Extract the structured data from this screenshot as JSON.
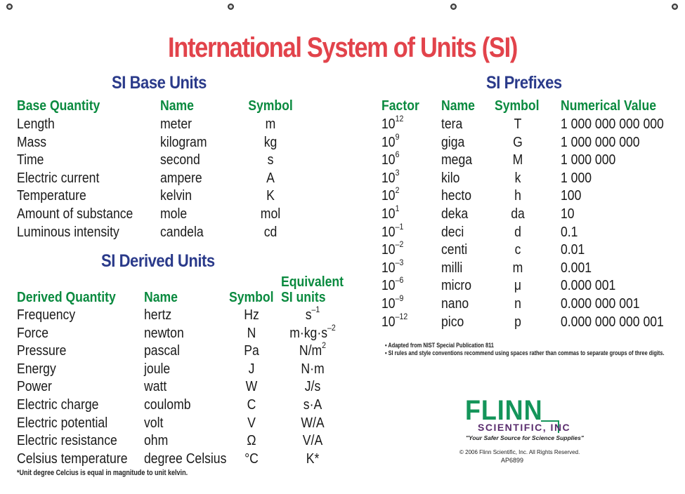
{
  "title": "International System of Units (SI)",
  "base_units": {
    "heading": "SI Base Units",
    "columns": [
      "Base Quantity",
      "Name",
      "Symbol"
    ],
    "rows": [
      [
        "Length",
        "meter",
        "m"
      ],
      [
        "Mass",
        "kilogram",
        "kg"
      ],
      [
        "Time",
        "second",
        "s"
      ],
      [
        "Electric current",
        "ampere",
        "A"
      ],
      [
        "Temperature",
        "kelvin",
        "K"
      ],
      [
        "Amount of substance",
        "mole",
        "mol"
      ],
      [
        "Luminous intensity",
        "candela",
        "cd"
      ]
    ]
  },
  "derived_units": {
    "heading": "SI Derived Units",
    "columns": [
      "Derived Quantity",
      "Name",
      "Symbol",
      "Equivalent",
      "SI units"
    ],
    "rows": [
      {
        "q": "Frequency",
        "name": "hertz",
        "sym": "Hz",
        "eq": "s",
        "eq_sup": "–1",
        "eq_tail": ""
      },
      {
        "q": "Force",
        "name": "newton",
        "sym": "N",
        "eq": "m·kg·s",
        "eq_sup": "–2",
        "eq_tail": ""
      },
      {
        "q": "Pressure",
        "name": "pascal",
        "sym": "Pa",
        "eq": "N/m",
        "eq_sup": "2",
        "eq_tail": ""
      },
      {
        "q": "Energy",
        "name": "joule",
        "sym": "J",
        "eq": "N·m",
        "eq_sup": "",
        "eq_tail": ""
      },
      {
        "q": "Power",
        "name": "watt",
        "sym": "W",
        "eq": "J/s",
        "eq_sup": "",
        "eq_tail": ""
      },
      {
        "q": "Electric charge",
        "name": "coulomb",
        "sym": "C",
        "eq": "s·A",
        "eq_sup": "",
        "eq_tail": ""
      },
      {
        "q": "Electric potential",
        "name": "volt",
        "sym": "V",
        "eq": "W/A",
        "eq_sup": "",
        "eq_tail": ""
      },
      {
        "q": "Electric resistance",
        "name": "ohm",
        "sym": "Ω",
        "eq": "V/A",
        "eq_sup": "",
        "eq_tail": ""
      },
      {
        "q": "Celsius temperature",
        "name": "degree Celsius",
        "sym": "°C",
        "eq": "K*",
        "eq_sup": "",
        "eq_tail": ""
      }
    ],
    "footnote": "*Unit degree Celcius is equal in magnitude to unit kelvin."
  },
  "prefixes": {
    "heading": "SI Prefixes",
    "columns": [
      "Factor",
      "Name",
      "Symbol",
      "Numerical Value"
    ],
    "rows": [
      {
        "base": "10",
        "exp": "12",
        "name": "tera",
        "sym": "T",
        "value": "1 000 000 000 000"
      },
      {
        "base": "10",
        "exp": "9",
        "name": "giga",
        "sym": "G",
        "value": "1 000 000 000"
      },
      {
        "base": "10",
        "exp": "6",
        "name": "mega",
        "sym": "M",
        "value": "1 000 000"
      },
      {
        "base": "10",
        "exp": "3",
        "name": "kilo",
        "sym": "k",
        "value": "1 000"
      },
      {
        "base": "10",
        "exp": "2",
        "name": "hecto",
        "sym": "h",
        "value": "100"
      },
      {
        "base": "10",
        "exp": "1",
        "name": "deka",
        "sym": "da",
        "value": "10"
      },
      {
        "base": "10",
        "exp": "–1",
        "name": "deci",
        "sym": "d",
        "value": "0.1"
      },
      {
        "base": "10",
        "exp": "–2",
        "name": "centi",
        "sym": "c",
        "value": "0.01"
      },
      {
        "base": "10",
        "exp": "–3",
        "name": "milli",
        "sym": "m",
        "value": "0.001"
      },
      {
        "base": "10",
        "exp": "–6",
        "name": "micro",
        "sym": "μ",
        "value": "0.000 001"
      },
      {
        "base": "10",
        "exp": "–9",
        "name": "nano",
        "sym": "n",
        "value": "0.000 000 001"
      },
      {
        "base": "10",
        "exp": "–12",
        "name": "pico",
        "sym": "p",
        "value": "0.000 000 000 001"
      }
    ],
    "notes": [
      "• Adapted from NIST Special Publication 811",
      "• SI rules and style conventions recommend using spaces rather than commas to separate groups of three digits."
    ]
  },
  "logo": {
    "brand": "FLINN",
    "company": "SCIENTIFIC, INC",
    "tagline": "\"Your Safer Source for Science Supplies\"",
    "copyright": "© 2006 Flinn Scientific, Inc. All Rights Reserved.",
    "code": "AP6899"
  },
  "colors": {
    "title": "#e2434b",
    "section_heading": "#2a3a8a",
    "column_header": "#0a8a3f",
    "logo_green": "#14955a",
    "logo_purple": "#5a2d6e"
  }
}
